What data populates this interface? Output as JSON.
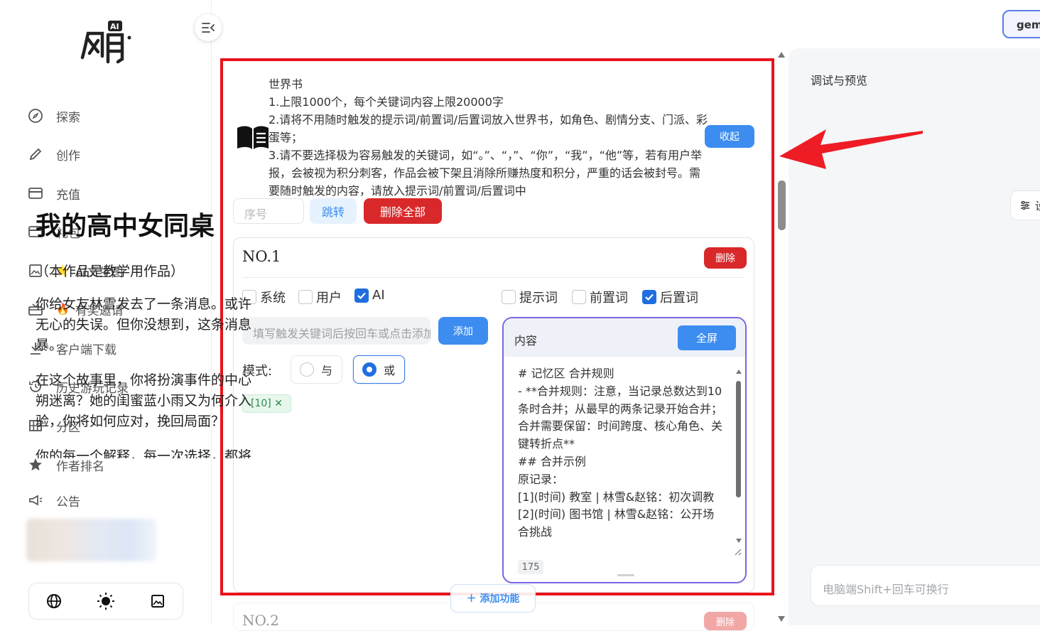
{
  "sidebar": {
    "items": [
      {
        "label": "探索",
        "icon": "compass-icon"
      },
      {
        "label": "创作",
        "icon": "pencil-icon"
      },
      {
        "label": "充值",
        "icon": "card-icon"
      },
      {
        "label": "礼包",
        "icon": "card-icon"
      },
      {
        "label": "AI文生图",
        "icon": "image-icon",
        "emoji": "⭐"
      },
      {
        "label": "有奖邀请",
        "icon": "gift-icon",
        "emoji": "🔥"
      },
      {
        "label": "客户端下载",
        "icon": "download-icon"
      },
      {
        "label": "历史游玩记录",
        "icon": "history-icon"
      },
      {
        "label": "分区",
        "icon": "grid-icon"
      },
      {
        "label": "作者排名",
        "icon": "star-icon"
      },
      {
        "label": "公告",
        "icon": "megaphone-icon"
      }
    ]
  },
  "header": {
    "model_label": "gemini"
  },
  "worldbook": {
    "lines": [
      "世界书",
      "1.上限1000个，每个关键词内容上限20000字",
      "2.请将不用随时触发的提示词/前置词/后置词放入世界书，如角色、剧情分支、门派、彩蛋等；",
      "3.请不要选择极为容易触发的关键词，如“。”、“，”、“你”，“我”，“他”等，若有用户举报，会被视为积分刺客，作品会被下架且消除所赚热度和积分，严重的话会被封号。需要随时触发的内容，请放入提示词/前置词/后置词中"
    ],
    "collapse_label": "收起",
    "seq_placeholder": "序号",
    "jump_label": "跳转",
    "delete_all_label": "删除全部"
  },
  "entry": {
    "title": "NO.1",
    "delete_label": "删除",
    "roles": [
      {
        "label": "系统",
        "checked": false
      },
      {
        "label": "用户",
        "checked": false
      },
      {
        "label": "AI",
        "checked": true
      }
    ],
    "positions": [
      {
        "label": "提示词",
        "checked": false
      },
      {
        "label": "前置词",
        "checked": false
      },
      {
        "label": "后置词",
        "checked": true
      }
    ],
    "keyword_placeholder": "填写触发关键词后按回车或点击添加",
    "add_label": "添加",
    "mode_label": "模式:",
    "mode_and": "与",
    "mode_or": "或",
    "mode_selected": "或",
    "tag": "[10] ✕",
    "content_label": "内容",
    "fullscreen_label": "全屏",
    "content_lines": [
      "# 记忆区 合并规则",
      "- **合并规则：注意，当记录总数达到10条时合并；从最早的两条记录开始合并；合并需要保留：时间跨度、核心角色、关键转折点**",
      "## 合并示例",
      "原记录：",
      "[1](时间) 教室 | 林雪&赵铭：初次调教",
      "[2](时间) 图书馆 | 林雪&赵铭：公开场合挑战"
    ],
    "char_count": "175"
  },
  "next_entry": {
    "title": "NO.2",
    "delete_label": "删除"
  },
  "add_function_label": "＋ 添加功能",
  "preview": {
    "title": "调试与预览",
    "settings_label": "设",
    "story_title": "我的高中女同桌",
    "story_subtitle": "（本作品是教学用作品）",
    "paragraphs": [
      [
        "你给女友林雪发去了一条消息。或许",
        "无心的失误。但你没想到，这条消息",
        "暴。"
      ],
      [
        "在这个故事里，你将扮演事件的中心",
        "朔迷离？她的闺蜜蓝小雨又为何介入",
        "验，你将如何应对，挽回局面？"
      ],
      [
        "你的每一个解释，每一次选择，都将"
      ]
    ],
    "input_placeholder": "电脑端Shift+回车可换行"
  },
  "colors": {
    "accent": "#3d8df0",
    "danger": "#d9282a",
    "highlight_border": "#e8141b",
    "content_border": "#7a66e0"
  }
}
